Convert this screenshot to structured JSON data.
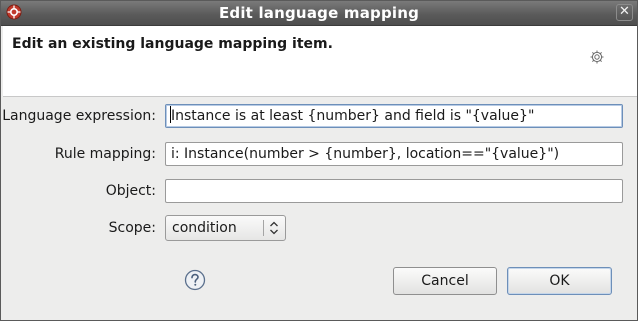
{
  "window": {
    "title": "Edit language mapping",
    "close_glyph": "✕"
  },
  "banner": {
    "title": "Edit an existing language mapping item.",
    "icon": "gear-icon"
  },
  "form": {
    "language_expression": {
      "label": "Language expression:",
      "value": "Instance is at least {number} and field is \"{value}\""
    },
    "rule_mapping": {
      "label": "Rule mapping:",
      "value": "i: Instance(number > {number}, location==\"{value}\")"
    },
    "object": {
      "label": "Object:",
      "value": ""
    },
    "scope": {
      "label": "Scope:",
      "selected": "condition"
    }
  },
  "buttons": {
    "help_icon": "help-icon",
    "cancel_label": "Cancel",
    "ok_label": "OK"
  },
  "colors": {
    "titlebar": "#5b5b5b",
    "dialog_bg": "#ededec",
    "focus_border": "#6d8fb9"
  }
}
